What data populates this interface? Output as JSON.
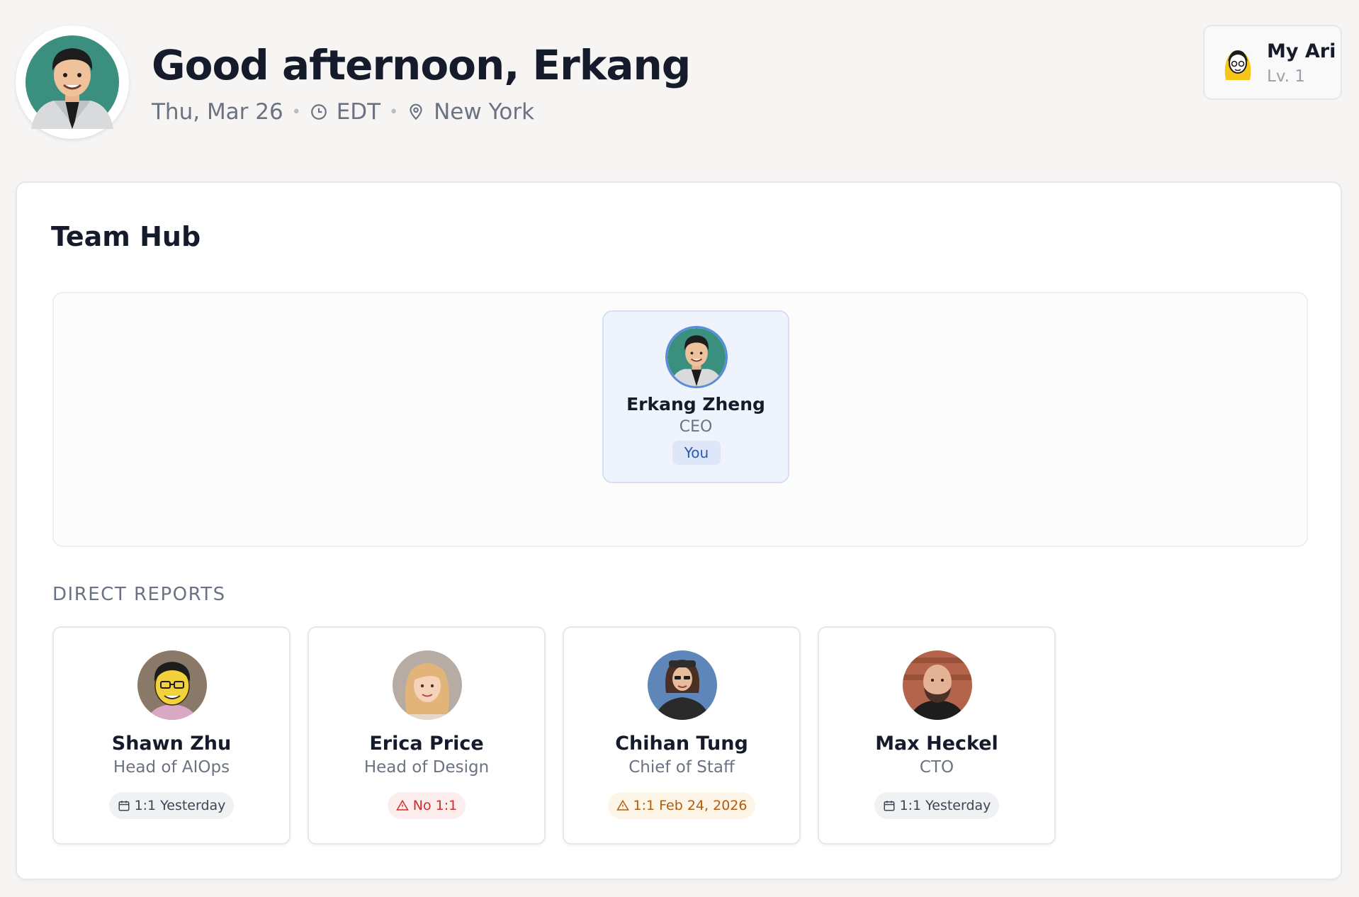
{
  "header": {
    "greeting": "Good afternoon, Erkang",
    "date": "Thu, Mar 26",
    "timezone": "EDT",
    "location": "New York",
    "avatar_icon": "user-caricature-avatar"
  },
  "my_ari": {
    "title": "My Ari",
    "level": "Lv. 1",
    "icon": "ari-character-icon"
  },
  "team_hub": {
    "title": "Team Hub",
    "self": {
      "name": "Erkang Zheng",
      "role": "CEO",
      "badge": "You"
    },
    "direct_reports_label": "DIRECT REPORTS",
    "direct_reports": [
      {
        "name": "Shawn Zhu",
        "role": "Head of AIOps",
        "status": "1:1 Yesterday",
        "status_type": "neutral",
        "status_icon": "calendar-icon"
      },
      {
        "name": "Erica Price",
        "role": "Head of Design",
        "status": "No 1:1",
        "status_type": "danger",
        "status_icon": "warning-icon"
      },
      {
        "name": "Chihan Tung",
        "role": "Chief of Staff",
        "status": "1:1 Feb 24, 2026",
        "status_type": "warning",
        "status_icon": "warning-icon"
      },
      {
        "name": "Max Heckel",
        "role": "CTO",
        "status": "1:1 Yesterday",
        "status_type": "neutral",
        "status_icon": "calendar-icon"
      }
    ]
  },
  "colors": {
    "background": "#f6f5f4",
    "accent_blue": "#5b8cdc",
    "danger": "#d42a2a",
    "warning": "#b35c0c"
  }
}
